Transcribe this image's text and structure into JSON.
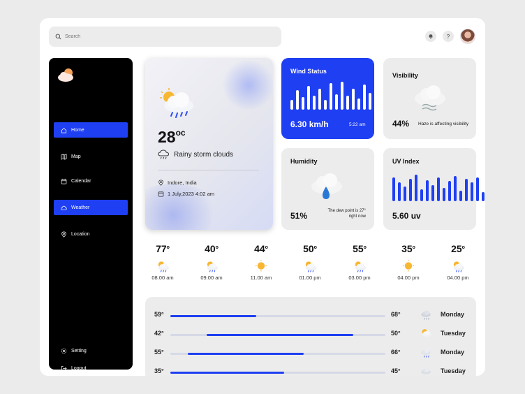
{
  "search": {
    "placeholder": "Search",
    "value": ""
  },
  "topbar": {
    "bell_icon": "bell-icon",
    "help_label": "?",
    "avatar_icon": "user-avatar"
  },
  "sidebar": {
    "logo_icon": "cloud-sun-logo",
    "items": [
      {
        "label": "Home",
        "icon": "home-icon",
        "active": true
      },
      {
        "label": "Map",
        "icon": "map-icon",
        "active": false
      },
      {
        "label": "Calendar",
        "icon": "calendar-icon",
        "active": false
      },
      {
        "label": "Weather",
        "icon": "cloud-icon",
        "active": true
      },
      {
        "label": "Location",
        "icon": "pin-icon",
        "active": false
      }
    ],
    "bottom_items": [
      {
        "label": "Setting",
        "icon": "gear-icon"
      },
      {
        "label": "Logout",
        "icon": "logout-icon"
      }
    ]
  },
  "current": {
    "temp": "28",
    "unit": "oc",
    "condition": "Rainy storm clouds",
    "location": "Indore, India",
    "datetime": "1 July,2023 4:02 am"
  },
  "wind": {
    "title": "Wind Status",
    "value": "6.30 km/h",
    "time": "5:22 am",
    "bars": [
      0.35,
      0.7,
      0.45,
      0.85,
      0.5,
      0.75,
      0.35,
      0.95,
      0.55,
      1.0,
      0.5,
      0.75,
      0.4,
      0.9,
      0.6,
      0.7,
      0.45
    ]
  },
  "visibility": {
    "title": "Visibility",
    "value": "44%",
    "note": "Haze is affecting visibility"
  },
  "humidity": {
    "title": "Humidity",
    "value": "51%",
    "note_line1": "The dew point is 27°",
    "note_line2": "right now"
  },
  "uv": {
    "title": "UV Index",
    "value": "5.60 uv",
    "bars": [
      0.9,
      0.7,
      0.55,
      0.85,
      1.0,
      0.45,
      0.8,
      0.6,
      0.9,
      0.5,
      0.75,
      0.95,
      0.4,
      0.85,
      0.7,
      0.9,
      0.35
    ]
  },
  "hourly": [
    {
      "temp": "77",
      "unit": "o",
      "time": "08.00 am",
      "icon": "sun-cloud-rain-icon"
    },
    {
      "temp": "40",
      "unit": "o",
      "time": "09.00 am",
      "icon": "sun-cloud-rain-icon"
    },
    {
      "temp": "44",
      "unit": "o",
      "time": "11.00 am",
      "icon": "sun-icon"
    },
    {
      "temp": "50",
      "unit": "o",
      "time": "01.00 pm",
      "icon": "sun-cloud-rain-icon"
    },
    {
      "temp": "55",
      "unit": "o",
      "time": "03.00 pm",
      "icon": "sun-cloud-rain-icon"
    },
    {
      "temp": "35",
      "unit": "o",
      "time": "04.00 pm",
      "icon": "sun-icon"
    },
    {
      "temp": "25",
      "unit": "o",
      "time": "04.00 pm",
      "icon": "sun-cloud-rain-icon"
    }
  ],
  "weekly": [
    {
      "low": "59°",
      "high": "68°",
      "day": "Monday",
      "range_start": 0.0,
      "range_end": 0.4,
      "icon": "rain-cloud-icon"
    },
    {
      "low": "42°",
      "high": "50°",
      "day": "Tuesday",
      "range_start": 0.17,
      "range_end": 0.85,
      "icon": "sun-cloud-icon"
    },
    {
      "low": "55°",
      "high": "66°",
      "day": "Monday",
      "range_start": 0.08,
      "range_end": 0.62,
      "icon": "storm-cloud-icon"
    },
    {
      "low": "35°",
      "high": "45°",
      "day": "Tuesday",
      "range_start": 0.0,
      "range_end": 0.53,
      "icon": "cloud-icon"
    }
  ],
  "colors": {
    "accent": "#1f3ff2",
    "sidebar": "#000000",
    "card": "#ececec"
  }
}
